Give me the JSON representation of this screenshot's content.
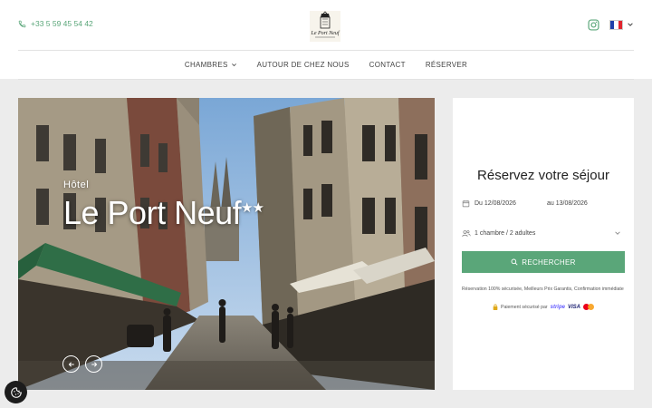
{
  "header": {
    "phone": "+33 5 59 45 54 42",
    "logo_text": "Le Port Neuf",
    "language_flag": "fr"
  },
  "nav": {
    "items": [
      {
        "label": "CHAMBRES",
        "has_dropdown": true
      },
      {
        "label": "AUTOUR DE CHEZ NOUS"
      },
      {
        "label": "CONTACT"
      },
      {
        "label": "RÉSERVER"
      }
    ]
  },
  "hero": {
    "subtitle": "Hôtel",
    "title": "Le Port Neuf",
    "stars": "★★"
  },
  "booking": {
    "title": "Réservez votre séjour",
    "date_from": "Du 12/08/2026",
    "date_to": "au 13/08/2026",
    "guests": "1 chambre / 2 adultes",
    "search_label": "RECHERCHER",
    "guarantee_text": "Réservation 100% sécurisée, Meilleurs Prix Garantis, Confirmation immédiate",
    "payment_text": "Paiement sécurisé par",
    "payment_brands": [
      "stripe",
      "VISA"
    ]
  },
  "colors": {
    "accent": "#5aa679",
    "background": "#ececec",
    "panel": "#ffffff"
  }
}
